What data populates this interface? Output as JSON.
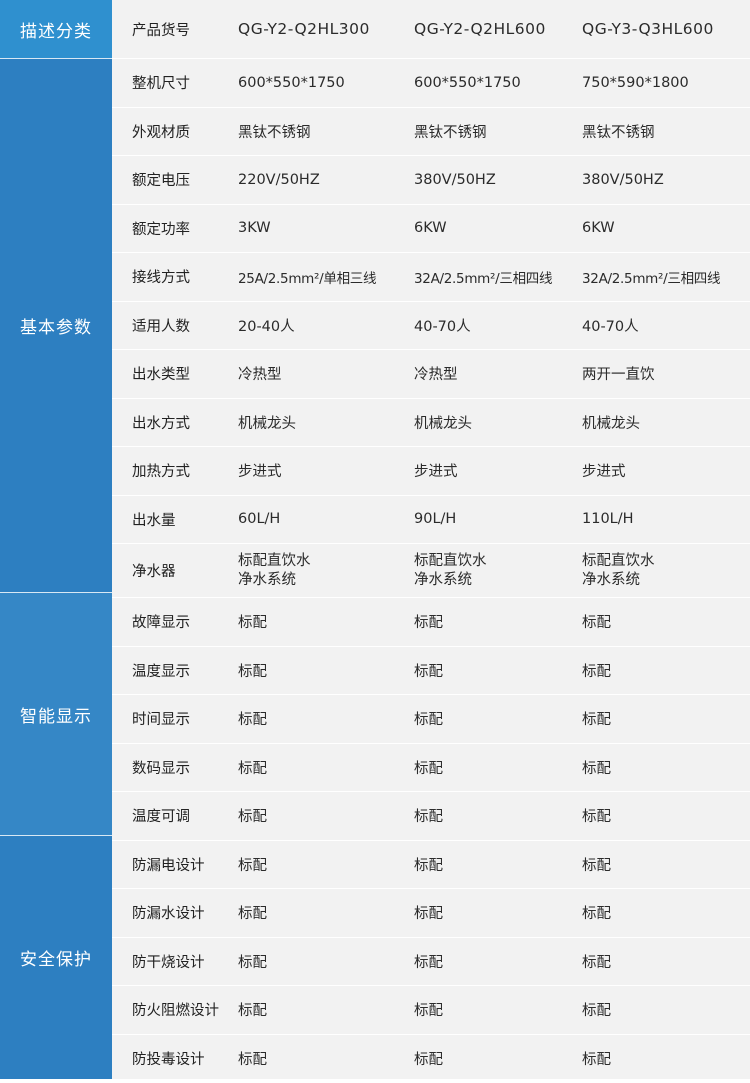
{
  "sections": {
    "header": "描述分类",
    "basic": "基本参数",
    "smart": "智能显示",
    "safety": "安全保护"
  },
  "header": {
    "label": "产品货号",
    "models": [
      "QG-Y2-Q2HL300",
      "QG-Y2-Q2HL600",
      "QG-Y3-Q3HL600"
    ]
  },
  "rows": [
    {
      "label": "整机尺寸",
      "values": [
        "600*550*1750",
        "600*550*1750",
        "750*590*1800"
      ]
    },
    {
      "label": "外观材质",
      "values": [
        "黑钛不锈钢",
        "黑钛不锈钢",
        "黑钛不锈钢"
      ]
    },
    {
      "label": "额定电压",
      "values": [
        "220V/50HZ",
        "380V/50HZ",
        "380V/50HZ"
      ]
    },
    {
      "label": "额定功率",
      "values": [
        "3KW",
        "6KW",
        "6KW"
      ]
    },
    {
      "label": "接线方式",
      "values": [
        "25A/2.5mm²/单相三线",
        "32A/2.5mm²/三相四线",
        "32A/2.5mm²/三相四线"
      ]
    },
    {
      "label": "适用人数",
      "values": [
        "20-40人",
        "40-70人",
        "40-70人"
      ]
    },
    {
      "label": "出水类型",
      "values": [
        "冷热型",
        "冷热型",
        "两开一直饮"
      ]
    },
    {
      "label": "出水方式",
      "values": [
        "机械龙头",
        "机械龙头",
        "机械龙头"
      ]
    },
    {
      "label": "加热方式",
      "values": [
        "步进式",
        "步进式",
        "步进式"
      ]
    },
    {
      "label": "出水量",
      "values": [
        "60L/H",
        "90L/H",
        "110L/H"
      ]
    },
    {
      "label": "净水器",
      "line1": [
        "标配直饮水",
        "标配直饮水",
        "标配直饮水"
      ],
      "line2": [
        "净水系统",
        "净水系统",
        "净水系统"
      ]
    },
    {
      "label": "故障显示",
      "values": [
        "标配",
        "标配",
        "标配"
      ]
    },
    {
      "label": "温度显示",
      "values": [
        "标配",
        "标配",
        "标配"
      ]
    },
    {
      "label": "时间显示",
      "values": [
        "标配",
        "标配",
        "标配"
      ]
    },
    {
      "label": "数码显示",
      "values": [
        "标配",
        "标配",
        "标配"
      ]
    },
    {
      "label": "温度可调",
      "values": [
        "标配",
        "标配",
        "标配"
      ]
    },
    {
      "label": "防漏电设计",
      "values": [
        "标配",
        "标配",
        "标配"
      ]
    },
    {
      "label": "防漏水设计",
      "values": [
        "标配",
        "标配",
        "标配"
      ]
    },
    {
      "label": "防干烧设计",
      "values": [
        "标配",
        "标配",
        "标配"
      ]
    },
    {
      "label": "防火阻燃设计",
      "values": [
        "标配",
        "标配",
        "标配"
      ]
    },
    {
      "label": "防投毒设计",
      "values": [
        "标配",
        "标配",
        "标配"
      ]
    }
  ],
  "colors": {
    "side_blue": "#2d7fc1",
    "header_blue": "#2f90cf",
    "row_bg": "#f2f2f2"
  }
}
